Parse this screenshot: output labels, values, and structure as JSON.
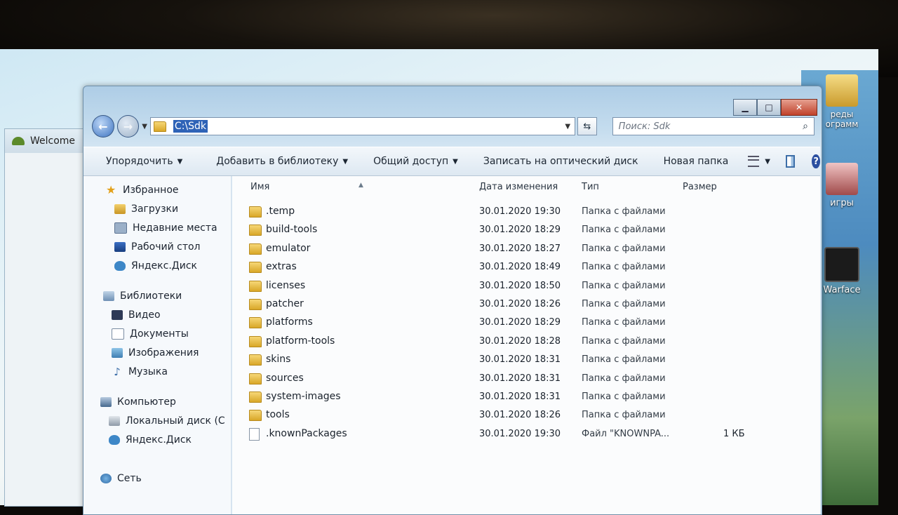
{
  "desktop": {
    "icons": [
      {
        "label": "реды\nограмм"
      },
      {
        "label": "игры"
      },
      {
        "label": "Warface"
      }
    ]
  },
  "bg_window": {
    "tab_label": "Welcome"
  },
  "explorer": {
    "address": {
      "path": "C:\\Sdk"
    },
    "search_placeholder": "Поиск: Sdk",
    "toolbar": {
      "organize": "Упорядочить",
      "add_to_library": "Добавить в библиотеку",
      "share": "Общий доступ",
      "burn": "Записать на оптический диск",
      "new_folder": "Новая папка"
    },
    "nav": {
      "favorites": "Избранное",
      "downloads": "Загрузки",
      "recent": "Недавние места",
      "desktop": "Рабочий стол",
      "yandex_disk": "Яндекс.Диск",
      "libraries": "Библиотеки",
      "video": "Видео",
      "documents": "Документы",
      "pictures": "Изображения",
      "music": "Музыка",
      "computer": "Компьютер",
      "local_disk": "Локальный диск (С",
      "yandex_disk_2": "Яндекс.Диск",
      "network": "Сеть"
    },
    "columns": {
      "name": "Имя",
      "date": "Дата изменения",
      "type": "Тип",
      "size": "Размер"
    },
    "rows": [
      {
        "name": ".temp",
        "date": "30.01.2020 19:30",
        "type": "Папка с файлами",
        "size": ""
      },
      {
        "name": "build-tools",
        "date": "30.01.2020 18:29",
        "type": "Папка с файлами",
        "size": ""
      },
      {
        "name": "emulator",
        "date": "30.01.2020 18:27",
        "type": "Папка с файлами",
        "size": ""
      },
      {
        "name": "extras",
        "date": "30.01.2020 18:49",
        "type": "Папка с файлами",
        "size": ""
      },
      {
        "name": "licenses",
        "date": "30.01.2020 18:50",
        "type": "Папка с файлами",
        "size": ""
      },
      {
        "name": "patcher",
        "date": "30.01.2020 18:26",
        "type": "Папка с файлами",
        "size": ""
      },
      {
        "name": "platforms",
        "date": "30.01.2020 18:29",
        "type": "Папка с файлами",
        "size": ""
      },
      {
        "name": "platform-tools",
        "date": "30.01.2020 18:28",
        "type": "Папка с файлами",
        "size": ""
      },
      {
        "name": "skins",
        "date": "30.01.2020 18:31",
        "type": "Папка с файлами",
        "size": ""
      },
      {
        "name": "sources",
        "date": "30.01.2020 18:31",
        "type": "Папка с файлами",
        "size": ""
      },
      {
        "name": "system-images",
        "date": "30.01.2020 18:31",
        "type": "Папка с файлами",
        "size": ""
      },
      {
        "name": "tools",
        "date": "30.01.2020 18:26",
        "type": "Папка с файлами",
        "size": ""
      },
      {
        "name": ".knownPackages",
        "date": "30.01.2020 19:30",
        "type": "Файл \"KNOWNPA...",
        "size": "1 КБ"
      }
    ]
  }
}
